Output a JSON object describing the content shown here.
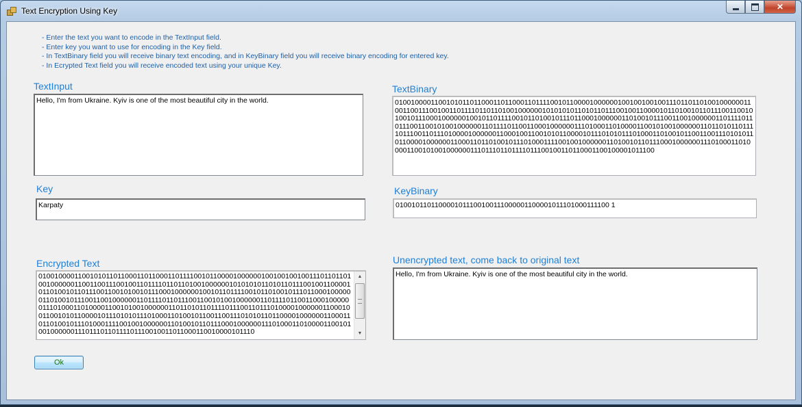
{
  "window": {
    "title": "Text Encryption Using Key",
    "close_glyph": "✕"
  },
  "instructions": [
    "- Enter the text you want to encode in the TextInput field.",
    "- Enter key you want to use for encoding in the Key field.",
    "- In TextBinary field you will receive binary text encoding, and in KeyBinary field you will receive binary encoding for entered key.",
    "- In Ecrypted Text field you will receive encoded text using your unique Key."
  ],
  "text_input": {
    "label": "TextInput",
    "value": "Hello, I'm from Ukraine. Kyiv is one of the most beautiful city in the world."
  },
  "text_binary": {
    "label": "TextBinary",
    "value": "01001000011001010110110001101100011011110010110000100000010010010010011101101101001000000110011001110010011011110110110100100000010101010110101101110010011000010110100101101110011001010010111000100000010010110111100101101001011101100010000001101001011100110010000001101111011011100110010100100000011011110110011000100000011101000110100001100101001000000110110101101111011100110111010000100000011000100110010101100001011101010111010001101001011001100111010101101100001000000110001101101001011101000111100100100000011010010110111000100000011101000110100001100101001000000111011101101111011100100110110001100100001011100"
  },
  "key": {
    "label": "Key",
    "value": "Karpaty"
  },
  "key_binary": {
    "label": "KeyBinary",
    "value": "0100101101100001011100100111000001100001011101000111100 1"
  },
  "encrypted_text": {
    "label": "Encrypted Text",
    "value": "0100100001100101011011000110110001101111001011000010000001001001001001110110110100100000011001100111001001101111011011010010000001010101011010110111001001100001011010010110111001100101001011100010000001001011011110010110100101110110001000000110100101110011001000000110111101101110011001010010000001101111011001100010000001110100011010000110010100100000011011010110111101110011011101000010000001100010011001010110000101110101011101000110100101100110011101010110110000100000011000110110100101110100011110010010000001101001011011100010000001110100011010000110010100100000011101110110111101110010011011000110010000101110"
  },
  "unencrypted_text": {
    "label": "Unencrypted text, come back to original text",
    "value": "Hello, I'm from Ukraine. Kyiv is one of the most beautiful city in the world."
  },
  "ok_button": {
    "label": "Ok"
  }
}
